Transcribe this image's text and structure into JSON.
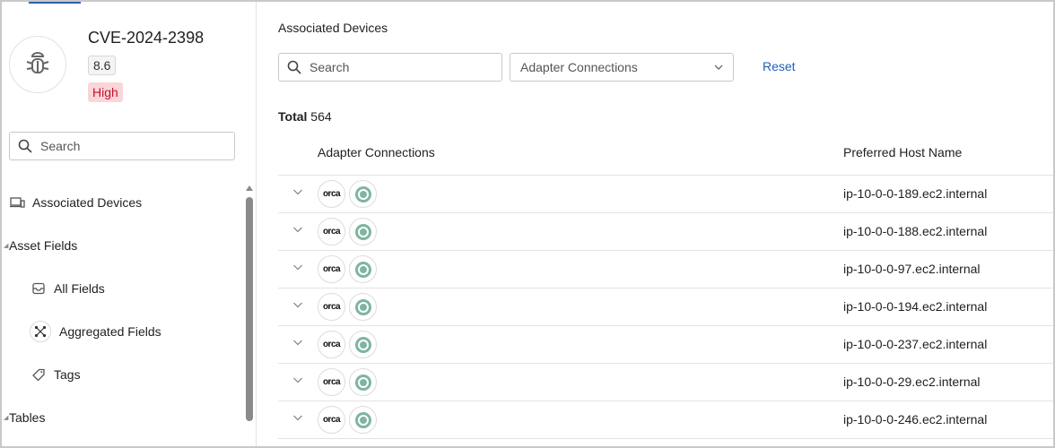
{
  "vulnerability": {
    "id": "CVE-2024-2398",
    "score": "8.6",
    "severity": "High",
    "severity_color": "#c8102e",
    "icon": "bug-icon"
  },
  "sidebar": {
    "search": {
      "placeholder": "Search"
    },
    "items": [
      {
        "label": "Associated Devices",
        "icon": "devices-icon"
      },
      {
        "label": "Asset Fields"
      },
      {
        "label": "All Fields",
        "icon": "inbox-icon"
      },
      {
        "label": "Aggregated Fields",
        "icon": "aggregate-icon"
      },
      {
        "label": "Tags",
        "icon": "tags-icon"
      },
      {
        "label": "Tables"
      }
    ]
  },
  "main": {
    "title": "Associated Devices",
    "search": {
      "placeholder": "Search"
    },
    "filter_select": {
      "value": "Adapter Connections"
    },
    "reset_label": "Reset",
    "total_label": "Total",
    "total_count": "564",
    "columns": [
      "Adapter Connections",
      "Preferred Host Name"
    ],
    "rows": [
      {
        "adapter_logo": "orca",
        "host": "ip-10-0-0-189.ec2.internal"
      },
      {
        "adapter_logo": "orca",
        "host": "ip-10-0-0-188.ec2.internal"
      },
      {
        "adapter_logo": "orca",
        "host": "ip-10-0-0-97.ec2.internal"
      },
      {
        "adapter_logo": "orca",
        "host": "ip-10-0-0-194.ec2.internal"
      },
      {
        "adapter_logo": "orca",
        "host": "ip-10-0-0-237.ec2.internal"
      },
      {
        "adapter_logo": "orca",
        "host": "ip-10-0-0-29.ec2.internal"
      },
      {
        "adapter_logo": "orca",
        "host": "ip-10-0-0-246.ec2.internal"
      }
    ]
  },
  "colors": {
    "accent": "#1f5fb8",
    "user_icon_green": "#7fb5a0"
  }
}
